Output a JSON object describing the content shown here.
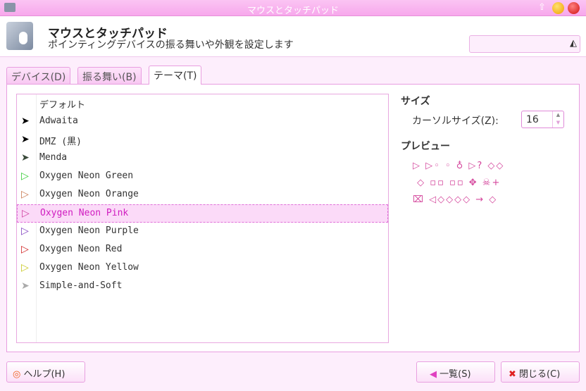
{
  "window": {
    "title": "マウスとタッチパッド"
  },
  "header": {
    "title": "マウスとタッチパッド",
    "subtitle": "ポインティングデバイスの振る舞いや外観を設定します",
    "search_icon": "clear-icon"
  },
  "tabs": [
    {
      "label": "デバイス(D)"
    },
    {
      "label": "振る舞い(B)"
    },
    {
      "label": "テーマ(T)",
      "active": true
    }
  ],
  "themes": [
    {
      "label": "デフォルト",
      "icon": "",
      "color": "#000000"
    },
    {
      "label": "Adwaita",
      "icon": "➤",
      "color": "#000000"
    },
    {
      "label": "DMZ (黒)",
      "icon": "➤",
      "color": "#000000"
    },
    {
      "label": "Menda",
      "icon": "➤",
      "color": "#3a4a3a"
    },
    {
      "label": "Oxygen Neon Green",
      "icon": "▷",
      "color": "#33cc33"
    },
    {
      "label": "Oxygen Neon Orange",
      "icon": "▷",
      "color": "#c87850"
    },
    {
      "label": "Oxygen Neon Pink",
      "icon": "▷",
      "color": "#d040a0",
      "selected": true
    },
    {
      "label": "Oxygen Neon Purple",
      "icon": "▷",
      "color": "#8040c0"
    },
    {
      "label": "Oxygen Neon Red",
      "icon": "▷",
      "color": "#d02020"
    },
    {
      "label": "Oxygen Neon Yellow",
      "icon": "▷",
      "color": "#c8c820"
    },
    {
      "label": "Simple-and-Soft",
      "icon": "➤",
      "color": "#aaaaaa"
    }
  ],
  "size": {
    "heading": "サイズ",
    "label": "カーソルサイズ(Z):",
    "value": "16"
  },
  "preview": {
    "heading": "プレビュー",
    "color": "#d4469c"
  },
  "buttons": {
    "help": "ヘルプ(H)",
    "overview": "一覧(S)",
    "close": "閉じる(C)"
  }
}
